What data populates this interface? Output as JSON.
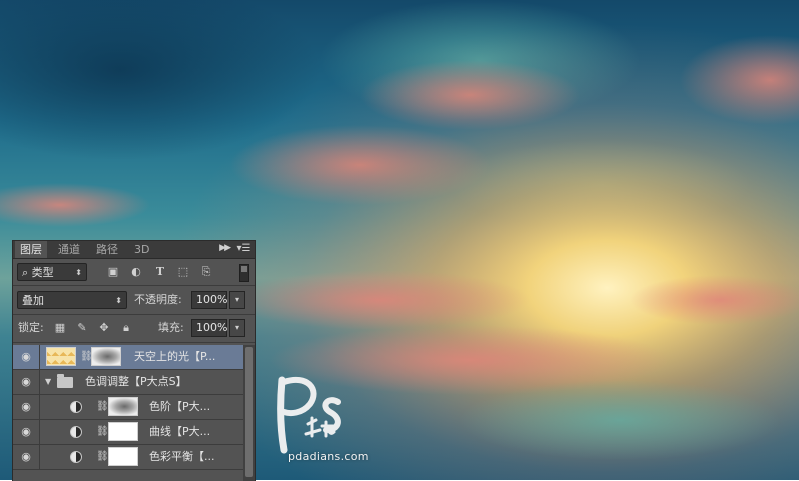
{
  "panel": {
    "tabs": [
      "图层",
      "通道",
      "路径",
      "3D"
    ],
    "filter_kind": "类型",
    "blend_mode": "叠加",
    "opacity_label": "不透明度:",
    "opacity_value": "100%",
    "lock_label": "锁定:",
    "fill_label": "填充:",
    "fill_value": "100%"
  },
  "layers": [
    {
      "name": "天空上的光【P...",
      "type": "pixel-with-mask",
      "selected": true,
      "visible": true
    },
    {
      "name": "色调调整【P大点S】",
      "type": "group",
      "expanded": true,
      "visible": true
    },
    {
      "name": "色阶【P大...",
      "type": "adjustment",
      "visible": true,
      "indent": true
    },
    {
      "name": "曲线【P大...",
      "type": "adjustment",
      "visible": true,
      "indent": true
    },
    {
      "name": "色彩平衡【...",
      "type": "adjustment",
      "visible": true,
      "indent": true
    }
  ],
  "watermark": {
    "url": "pdadians.com",
    "logo_text": "P大点S"
  },
  "colors": {
    "panel_bg": "#535353",
    "selected_row": "#6a7b96",
    "sky_top": "#1c5f82",
    "sky_glow": "#f6d27a",
    "cloud_pink": "#e08a72"
  }
}
